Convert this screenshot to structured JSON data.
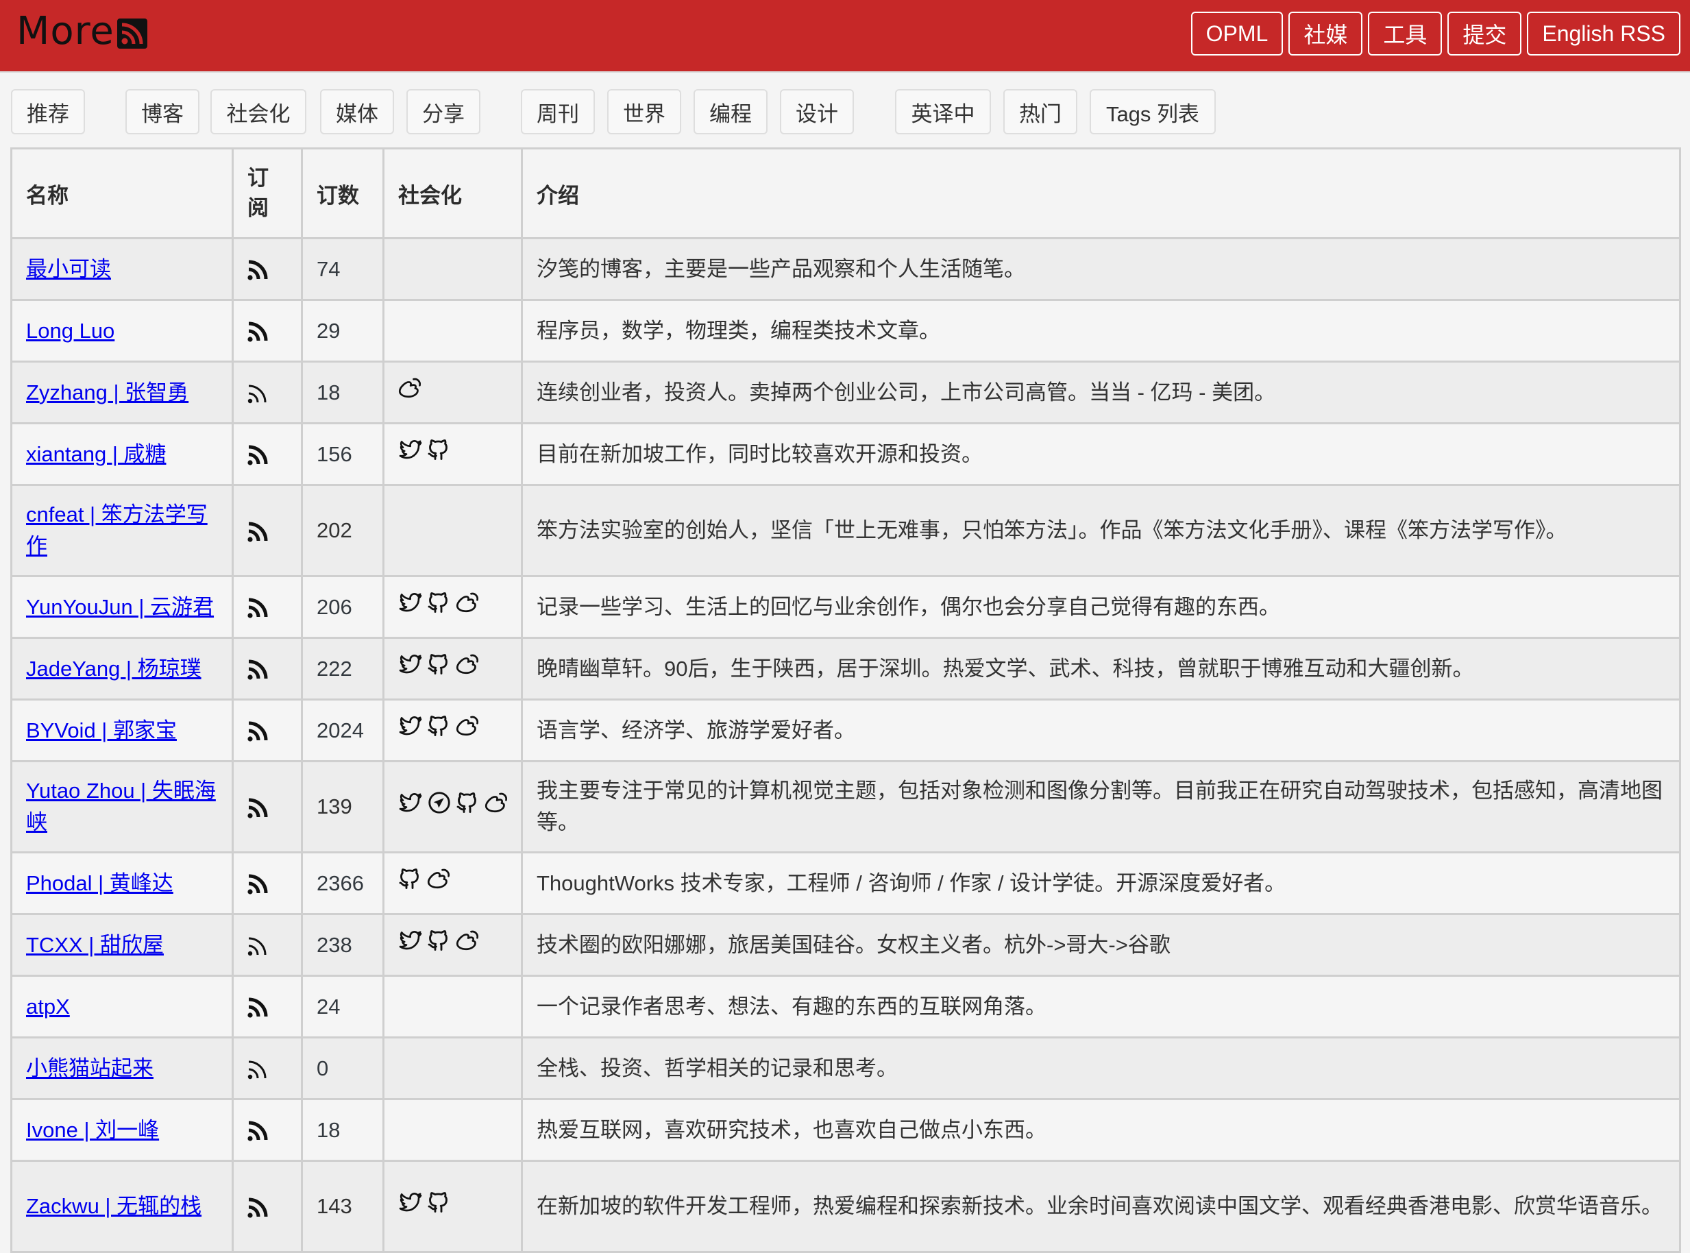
{
  "header": {
    "logo_text": "More",
    "nav": [
      "OPML",
      "社媒",
      "工具",
      "提交",
      "English RSS"
    ]
  },
  "tabs": [
    "推荐",
    "博客",
    "社会化",
    "媒体",
    "分享",
    "周刊",
    "世界",
    "编程",
    "设计",
    "英译中",
    "热门",
    "Tags 列表"
  ],
  "table": {
    "columns": [
      "名称",
      "订\n阅",
      "订数",
      "社会化",
      "介绍"
    ],
    "column_sub": {
      "c1a": "订",
      "c1b": "阅"
    },
    "rows": [
      {
        "name": "最小可读",
        "rss_style": "bold",
        "count": "74",
        "social": [],
        "desc": "汐笺的博客，主要是一些产品观察和个人生活随笔。"
      },
      {
        "name": "Long Luo",
        "rss_style": "bold",
        "count": "29",
        "social": [],
        "desc": "程序员，数学，物理类，编程类技术文章。"
      },
      {
        "name": "Zyzhang | 张智勇",
        "rss_style": "thin",
        "count": "18",
        "social": [
          "weibo"
        ],
        "desc": "连续创业者，投资人。卖掉两个创业公司，上市公司高管。当当 - 亿玛 - 美团。"
      },
      {
        "name": "xiantang | 咸糖",
        "rss_style": "bold",
        "count": "156",
        "social": [
          "twitter",
          "github"
        ],
        "desc": "目前在新加坡工作，同时比较喜欢开源和投资。"
      },
      {
        "name": "cnfeat | 笨方法学写作",
        "rss_style": "bold",
        "count": "202",
        "social": [],
        "desc": "笨方法实验室的创始人，坚信「世上无难事，只怕笨方法」。作品《笨方法文化手册》、课程《笨方法学写作》。",
        "tall": true
      },
      {
        "name": "YunYouJun | 云游君",
        "rss_style": "bold",
        "count": "206",
        "social": [
          "twitter",
          "github",
          "weibo"
        ],
        "desc": "记录一些学习、生活上的回忆与业余创作，偶尔也会分享自己觉得有趣的东西。"
      },
      {
        "name": "JadeYang | 杨琼璞",
        "rss_style": "bold",
        "count": "222",
        "social": [
          "twitter",
          "github",
          "weibo"
        ],
        "desc": "晚晴幽草轩。90后，生于陕西，居于深圳。热爱文学、武术、科技，曾就职于博雅互动和大疆创新。"
      },
      {
        "name": "BYVoid | 郭家宝",
        "rss_style": "bold",
        "count": "2024",
        "social": [
          "twitter",
          "github",
          "weibo"
        ],
        "desc": "语言学、经济学、旅游学爱好者。"
      },
      {
        "name": "Yutao Zhou | 失眠海峡",
        "rss_style": "bold",
        "count": "139",
        "social": [
          "twitter",
          "telegram",
          "github",
          "weibo"
        ],
        "desc": "我主要专注于常见的计算机视觉主题，包括对象检测和图像分割等。目前我正在研究自动驾驶技术，包括感知，高清地图等。",
        "tall": true
      },
      {
        "name": "Phodal | 黄峰达",
        "rss_style": "bold",
        "count": "2366",
        "social": [
          "github",
          "weibo"
        ],
        "desc": "ThoughtWorks 技术专家，工程师 / 咨询师 / 作家 / 设计学徒。开源深度爱好者。"
      },
      {
        "name": "TCXX | 甜欣屋",
        "rss_style": "thin",
        "count": "238",
        "social": [
          "twitter",
          "github",
          "weibo"
        ],
        "desc": "技术圈的欧阳娜娜，旅居美国硅谷。女权主义者。杭外->哥大->谷歌"
      },
      {
        "name": "atpX",
        "rss_style": "bold",
        "count": "24",
        "social": [],
        "desc": "一个记录作者思考、想法、有趣的东西的互联网角落。"
      },
      {
        "name": "小熊猫站起来",
        "rss_style": "thin",
        "count": "0",
        "social": [],
        "desc": "全栈、投资、哲学相关的记录和思考。"
      },
      {
        "name": "Ivone | 刘一峰",
        "rss_style": "bold",
        "count": "18",
        "social": [],
        "desc": "热爱互联网，喜欢研究技术，也喜欢自己做点小东西。"
      },
      {
        "name": "Zackwu | 无辄的栈",
        "rss_style": "bold",
        "count": "143",
        "social": [
          "twitter",
          "github"
        ],
        "desc": "在新加坡的软件开发工程师，热爱编程和探索新技术。业余时间喜欢阅读中国文学、观看经典香港电影、欣赏华语音乐。",
        "tall": true
      }
    ]
  },
  "colors": {
    "brand": "#c62828",
    "link": "#0000ee",
    "background": "#f4f4f4"
  }
}
